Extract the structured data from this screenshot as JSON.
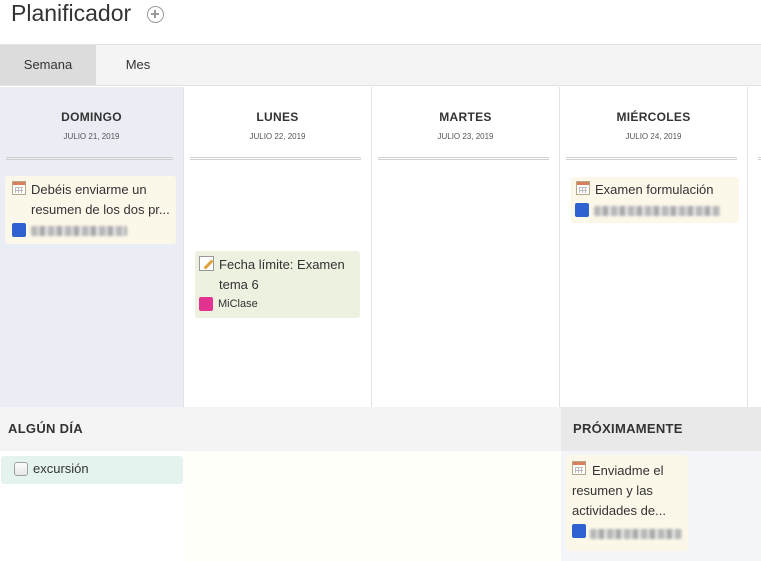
{
  "app": {
    "title": "Planificador"
  },
  "tabs": [
    {
      "label": "Semana",
      "active": true
    },
    {
      "label": "Mes",
      "active": false
    }
  ],
  "days": [
    {
      "name": "DOMINGO",
      "date": "JULIO 21, 2019"
    },
    {
      "name": "LUNES",
      "date": "JULIO 22, 2019"
    },
    {
      "name": "MARTES",
      "date": "JULIO 23, 2019"
    },
    {
      "name": "MIÉRCOLES",
      "date": "JULIO 24, 2019"
    }
  ],
  "items": {
    "sunday_event": {
      "text": "Debéis enviarme un resumen de los dos pr...",
      "icon": "calendar-icon",
      "course_color": "#2f62d0"
    },
    "monday_assignment": {
      "text": "Fecha límite: Examen tema 6",
      "icon": "pencil-icon",
      "course": "MiClase",
      "course_color": "#e1338f"
    },
    "wednesday_event": {
      "text": "Examen formulación",
      "icon": "calendar-icon",
      "course_color": "#2f62d0"
    }
  },
  "someday": {
    "title": "ALGÚN DÍA",
    "items": [
      {
        "text": "excursión",
        "icon": "checkbox-icon"
      }
    ]
  },
  "upcoming": {
    "title": "PRÓXIMAMENTE",
    "items": [
      {
        "text": "Enviadme el resumen y las actividades de...",
        "icon": "calendar-icon",
        "course_color": "#2f62d0"
      }
    ]
  },
  "colors": {
    "today_background": "#ebedf4",
    "event_card": "#fbf7e9",
    "assignment_card": "#edf1e0",
    "todo_card": "#e5f3ee"
  }
}
